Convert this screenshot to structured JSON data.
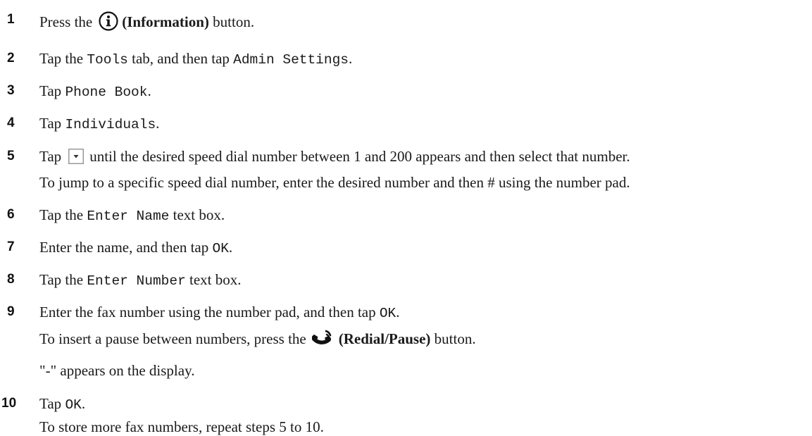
{
  "steps": [
    {
      "number": "1",
      "pre": "Press the",
      "icon": "info-icon",
      "bold": "(Information)",
      "post": "button."
    },
    {
      "number": "2",
      "pre": "Tap the ",
      "code1": "Tools",
      "mid": " tab, and then tap ",
      "code2": "Admin Settings",
      "post": "."
    },
    {
      "number": "3",
      "pre": "Tap ",
      "code1": "Phone Book",
      "post": "."
    },
    {
      "number": "4",
      "pre": "Tap ",
      "code1": "Individuals",
      "post": "."
    },
    {
      "number": "5",
      "pre": "Tap",
      "icon": "dropdown-arrow-icon",
      "post": "until the desired speed dial number between 1 and 200 appears and then select that number.",
      "note": "To jump to a specific speed dial number, enter the desired number and then # using the number pad."
    },
    {
      "number": "6",
      "pre": "Tap the ",
      "code1": "Enter Name",
      "post": " text box."
    },
    {
      "number": "7",
      "pre": "Enter the name, and then tap ",
      "code1": "OK",
      "post": "."
    },
    {
      "number": "8",
      "pre": "Tap the ",
      "code1": "Enter Number",
      "post": " text box."
    },
    {
      "number": "9",
      "pre": "Enter the fax number using the number pad, and then tap ",
      "code1": "OK",
      "post": ".",
      "note_pre": "To insert a pause between numbers, press the",
      "note_icon": "redial-pause-icon",
      "note_bold": "(Redial/Pause)",
      "note_post": "button.",
      "note2": "\"-\" appears on the display."
    },
    {
      "number": "10",
      "pre": "Tap ",
      "code1": "OK",
      "post": ".",
      "note": "To store more fax numbers, repeat steps 5 to 10."
    }
  ]
}
